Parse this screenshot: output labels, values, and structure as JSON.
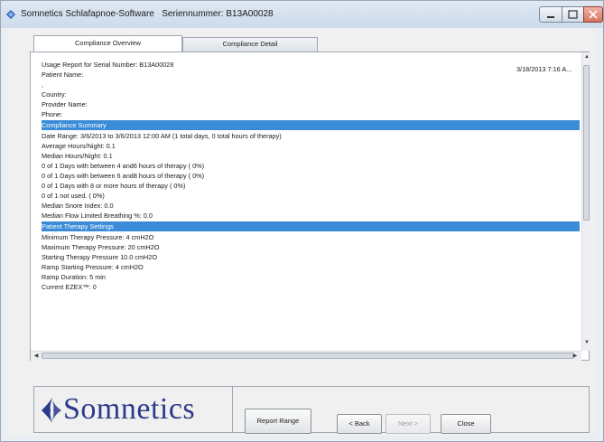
{
  "window": {
    "title": "Somnetics Schlafapnoe-Software",
    "serial_label": "Seriennummer:",
    "serial_value": "B13A00028"
  },
  "tabs": [
    {
      "label": "Compliance Overview",
      "active": true
    },
    {
      "label": "Compliance Detail",
      "active": false
    }
  ],
  "report": {
    "datetime": "3/18/2013 7:16 A...",
    "lines_header": [
      "Usage Report for Serial Number: B13A00028",
      "Patient Name:",
      ",",
      "Country:",
      "Provider Name:",
      "Phone:"
    ],
    "section_compliance": "Compliance Summary",
    "lines_compliance": [
      "Date Range: 3/6/2013 to 3/6/2013 12:00 AM (1 total days, 0 total hours of therapy)",
      "Average Hours/Night:   0.1",
      "Median Hours/Night:   0.1",
      "0 of 1 Days with between 4 and6 hours of therapy (  0%)",
      "0 of 1 Days with between 6 and8 hours of therapy (  0%)",
      "0 of 1 Days with 8 or more hours of therapy (  0%)",
      "0 of 1 not used. (  0%)",
      "Median Snore Index:   0.0",
      "Median Flow Limited Breathing %:    0.0"
    ],
    "section_therapy": "Patient Therapy Settings",
    "lines_therapy": [
      "Minimum Therapy Pressure: 4 cmH2O",
      "Maximum Therapy Pressure: 20 cmH2O",
      "Starting Therapy Pressure 10.0 cmH2O",
      "Ramp Starting Pressure: 4 cmH2O",
      "Ramp Duration: 5 min",
      "Current EZEX™: 0"
    ]
  },
  "footer": {
    "logo_text": "Somnetics",
    "report_range": "Report Range",
    "back": "< Back",
    "next": "Next >",
    "close": "Close"
  },
  "colors": {
    "section_bar": "#3b8cd8",
    "logo": "#2b3a8c"
  }
}
